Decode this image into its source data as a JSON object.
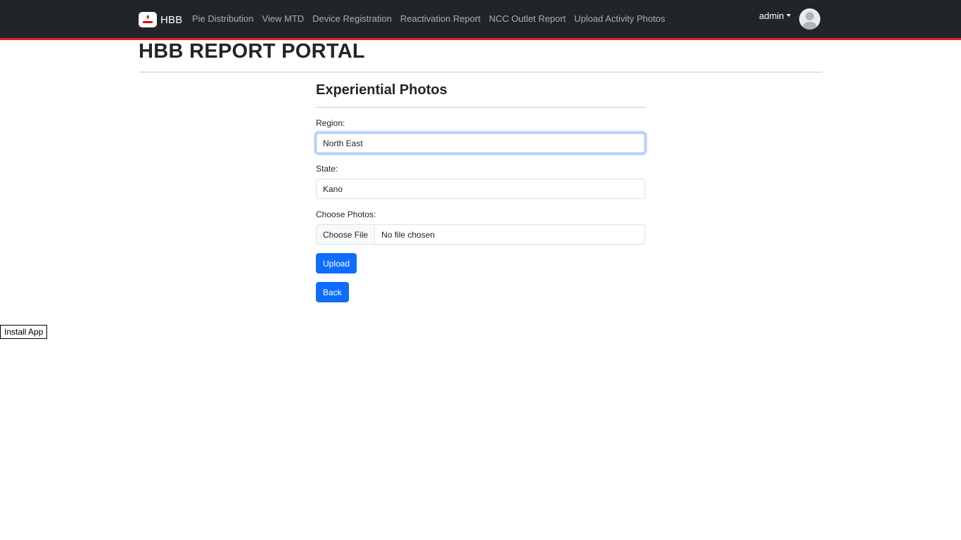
{
  "navbar": {
    "brand": "HBB",
    "brand_logo_icon": "airtel-logo-icon",
    "links": [
      "Pie Distribution",
      "View MTD",
      "Device Registration",
      "Reactivation Report",
      "NCC Outlet Report",
      "Upload Activity Photos"
    ],
    "user": "admin",
    "avatar_icon": "user-avatar-icon",
    "accent_color": "#dc1f24",
    "background_color": "#212529"
  },
  "page": {
    "title": "HBB REPORT PORTAL"
  },
  "form": {
    "title": "Experiential Photos",
    "region_label": "Region:",
    "region_value": "North East",
    "state_label": "State:",
    "state_value": "Kano",
    "photos_label": "Choose Photos:",
    "file_button_label": "Choose File",
    "file_status": "No file chosen",
    "upload_label": "Upload",
    "back_label": "Back",
    "button_color": "#0d6efd"
  },
  "install": {
    "label": "Install App"
  }
}
